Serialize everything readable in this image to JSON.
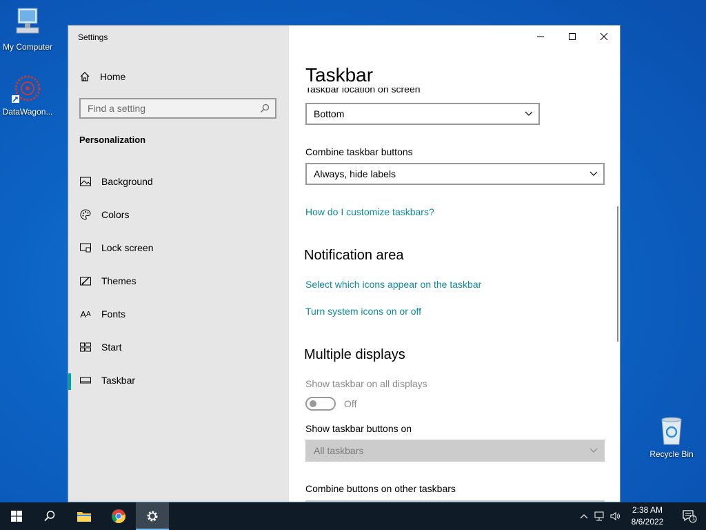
{
  "desktop": {
    "icons": [
      {
        "label": "My Computer"
      },
      {
        "label": "DataWagon..."
      },
      {
        "label": "Recycle Bin"
      }
    ]
  },
  "window": {
    "title": "Settings",
    "sidebar": {
      "home_label": "Home",
      "search_placeholder": "Find a setting",
      "section": "Personalization",
      "items": [
        {
          "label": "Background",
          "icon": "picture-icon"
        },
        {
          "label": "Colors",
          "icon": "palette-icon"
        },
        {
          "label": "Lock screen",
          "icon": "lock-screen-icon"
        },
        {
          "label": "Themes",
          "icon": "themes-icon"
        },
        {
          "label": "Fonts",
          "icon": "fonts-icon"
        },
        {
          "label": "Start",
          "icon": "start-icon"
        },
        {
          "label": "Taskbar",
          "icon": "taskbar-icon",
          "active": true
        }
      ]
    },
    "content": {
      "title": "Taskbar",
      "location_label": "Taskbar location on screen",
      "location_value": "Bottom",
      "combine_label": "Combine taskbar buttons",
      "combine_value": "Always, hide labels",
      "customize_link": "How do I customize taskbars?",
      "notification_header": "Notification area",
      "notif_link_1": "Select which icons appear on the taskbar",
      "notif_link_2": "Turn system icons on or off",
      "multiple_header": "Multiple displays",
      "show_all_label": "Show taskbar on all displays",
      "toggle_state": "Off",
      "show_buttons_label": "Show taskbar buttons on",
      "show_buttons_value": "All taskbars",
      "combine_other_label": "Combine buttons on other taskbars"
    }
  },
  "taskbar": {
    "time": "2:38 AM",
    "date": "8/6/2022",
    "notification_count": "1",
    "accent": "#76b9ed"
  }
}
